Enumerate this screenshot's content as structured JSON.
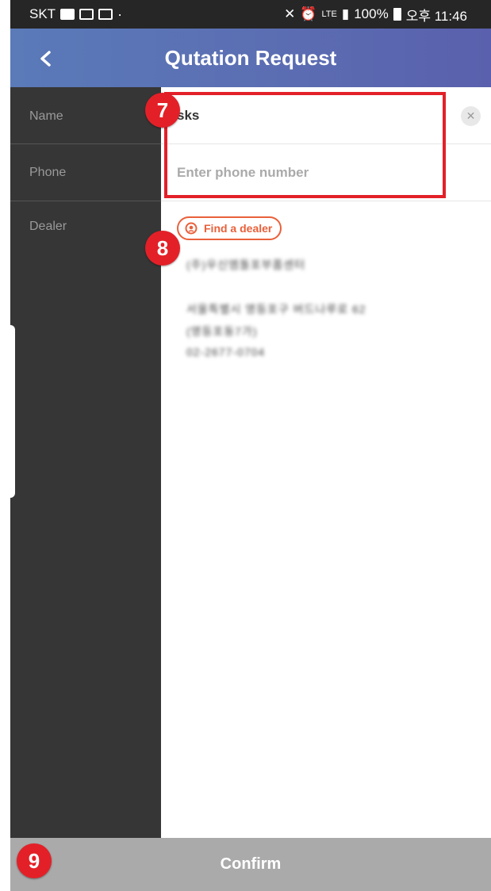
{
  "status_bar": {
    "carrier": "SKT",
    "battery": "100%",
    "time": "오후 11:46",
    "network": "LTE"
  },
  "header": {
    "title": "Qutation Request",
    "back_icon": "chevron-left-icon"
  },
  "form": {
    "labels": [
      "Name",
      "Phone",
      "Dealer"
    ],
    "name_value": "sks",
    "phone_placeholder": "Enter phone number",
    "find_dealer_label": "Find a dealer",
    "dealer_info_lines": [
      "(주)우신엠돌포부품센터",
      "서울특별시 영등포구 버드나루로 62",
      "(영등포동7가)",
      "02-2677-0704"
    ]
  },
  "confirm_label": "Confirm",
  "annotations": {
    "badge_7": "7",
    "badge_8": "8",
    "badge_9": "9"
  },
  "colors": {
    "accent": "#e9603a",
    "highlight": "#e32028",
    "header": "#5b6fb3",
    "sidebar": "#363636",
    "confirm": "#aaaaaa"
  }
}
